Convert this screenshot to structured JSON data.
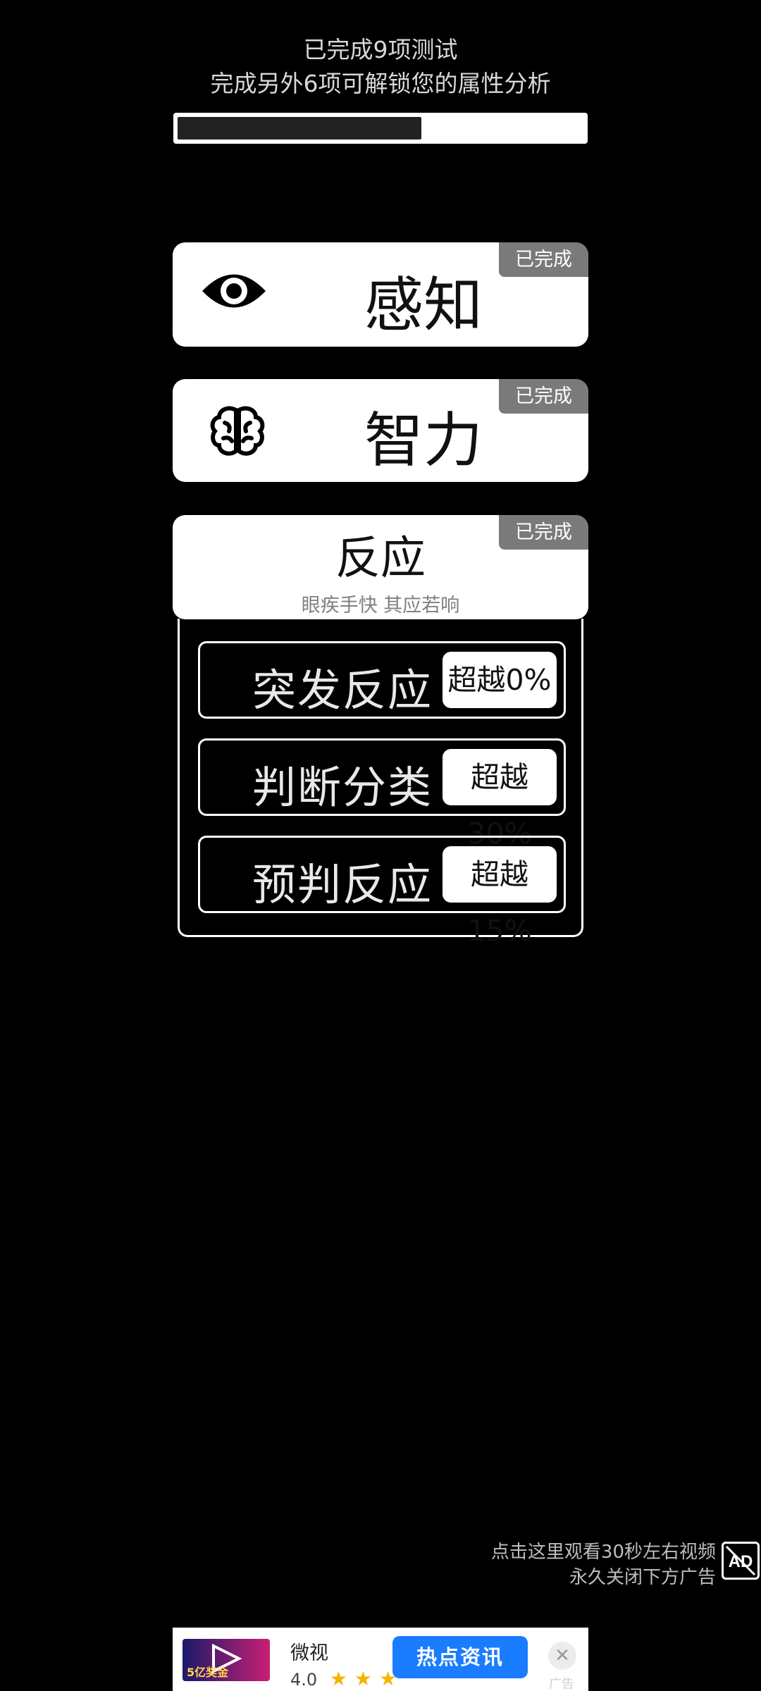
{
  "header": {
    "line1": "已完成9项测试",
    "line2": "完成另外6项可解锁您的属性分析",
    "progress": {
      "completed": 9,
      "total": 15
    }
  },
  "categories": [
    {
      "title": "感知",
      "badge": "已完成",
      "icon": "eye-icon"
    },
    {
      "title": "智力",
      "badge": "已完成",
      "icon": "brain-icon"
    },
    {
      "title": "反应",
      "subtitle": "眼疾手快 其应若响",
      "badge": "已完成",
      "items": [
        {
          "label": "突发反应",
          "result": "超越0%"
        },
        {
          "label": "判断分类",
          "result": "超越30%"
        },
        {
          "label": "预判反应",
          "result": "超越15%"
        }
      ]
    }
  ],
  "ad_prompt": {
    "line1": "点击这里观看30秒左右视频",
    "line2": "永久关闭下方广告",
    "icon": "no-ad-icon"
  },
  "banner_ad": {
    "app_name": "微视",
    "thumb_text": "5亿奖金",
    "rating": "4.0",
    "button": "热点资讯",
    "ad_label": "广告",
    "colors": {
      "button": "#1a7cff",
      "star": "#f4b400"
    }
  }
}
